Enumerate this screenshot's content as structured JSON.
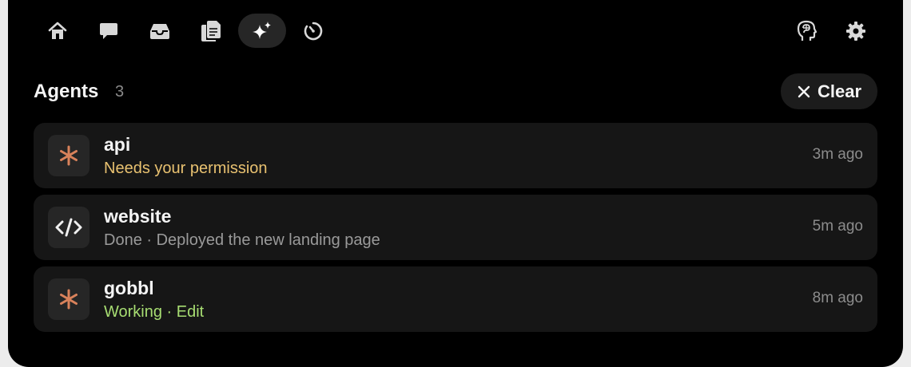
{
  "nav": {
    "tabs": [
      {
        "name": "home",
        "icon": "home-icon",
        "active": false
      },
      {
        "name": "chat",
        "icon": "chat-bubble-icon",
        "active": false
      },
      {
        "name": "inbox",
        "icon": "inbox-tray-icon",
        "active": false
      },
      {
        "name": "files",
        "icon": "documents-icon",
        "active": false
      },
      {
        "name": "agents",
        "icon": "sparkles-icon",
        "active": true
      },
      {
        "name": "history",
        "icon": "timer-icon",
        "active": false
      }
    ],
    "right_icons": [
      "brain-head-icon",
      "gear-icon"
    ]
  },
  "section": {
    "title": "Agents",
    "count": "3",
    "clear_label": "Clear"
  },
  "agents": [
    {
      "name": "api",
      "status": "Needs your permission",
      "status_color": "#e8c170",
      "time": "3m ago",
      "icon": "asterisk-icon",
      "icon_color": "#d9825b"
    },
    {
      "name": "website",
      "status": "Done · Deployed the new landing page",
      "status_color": "#9a9a9a",
      "time": "5m ago",
      "icon": "code-icon",
      "icon_color": "#f0f0f0"
    },
    {
      "name": "gobbl",
      "status": "Working · Edit",
      "status_color": "#a7dd72",
      "time": "8m ago",
      "icon": "asterisk-icon",
      "icon_color": "#d9825b"
    }
  ],
  "colors": {
    "background": "#000000",
    "card": "#161616",
    "text_primary": "#f4f4f4",
    "text_muted": "#8c8c8c"
  }
}
